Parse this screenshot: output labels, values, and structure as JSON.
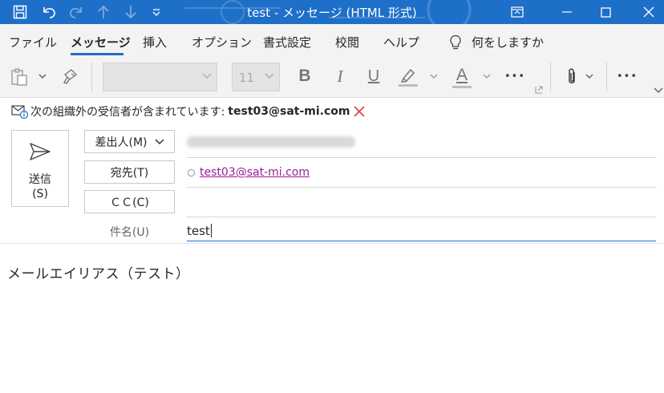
{
  "window": {
    "title": "test  -  メッセージ (HTML 形式)"
  },
  "tabs": [
    {
      "label": "ファイル"
    },
    {
      "label": "メッセージ"
    },
    {
      "label": "挿入"
    },
    {
      "label": "オプション"
    },
    {
      "label": "書式設定"
    },
    {
      "label": "校閲"
    },
    {
      "label": "ヘルプ"
    }
  ],
  "search": {
    "label": "何をしますか"
  },
  "ribbon": {
    "font_size": "11",
    "bold": "B",
    "italic": "I",
    "underline": "U",
    "font_color_letter": "A",
    "more": "•••"
  },
  "infobar": {
    "message": "次の組織外の受信者が含まれています:",
    "address": "test03@sat-mi.com"
  },
  "compose": {
    "send_label_1": "送信",
    "send_label_2": "(S)",
    "from_label": "差出人(M)",
    "to_label": "宛先(T)",
    "cc_label": "ＣＣ(C)",
    "subject_label": "件名(U)",
    "to_recipient": "test03@sat-mi.com",
    "subject_value": "test",
    "body": "メールエイリアス（テスト）"
  },
  "colors": {
    "titlebar": "#1e6fc8",
    "accent": "#1e6fc8",
    "link": "#9b1a9b",
    "remove_x": "#e04040"
  }
}
